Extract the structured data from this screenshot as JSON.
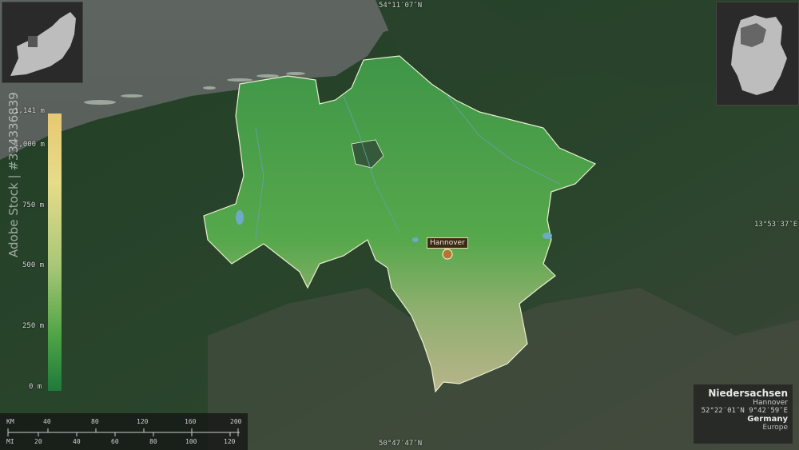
{
  "map": {
    "coords": {
      "top": "54°11′07″N",
      "bottom": "50°47′47″N",
      "right": "13°53′37″E"
    },
    "city": "Hannover"
  },
  "legend": {
    "labels": [
      "1,141 m",
      "1,000 m",
      "750 m",
      "500 m",
      "250 m",
      "0 m"
    ]
  },
  "scale": {
    "km_unit": "KM",
    "km_ticks": [
      "40",
      "80",
      "120",
      "160",
      "200"
    ],
    "mi_unit": "MI",
    "mi_ticks": [
      "20",
      "40",
      "60",
      "80",
      "100",
      "120"
    ]
  },
  "info": {
    "region": "Niedersachsen",
    "capital": "Hannover",
    "coordinates": "52°22′01″N 9°42′59″E",
    "country": "Germany",
    "continent": "Europe"
  },
  "watermark": "Adobe Stock | #334336839",
  "colors": {
    "sea": "#5c6560",
    "land_dark": "#1f3a24",
    "region_green": "#4b9e4c",
    "border_highlight": "#e8f0d0"
  }
}
